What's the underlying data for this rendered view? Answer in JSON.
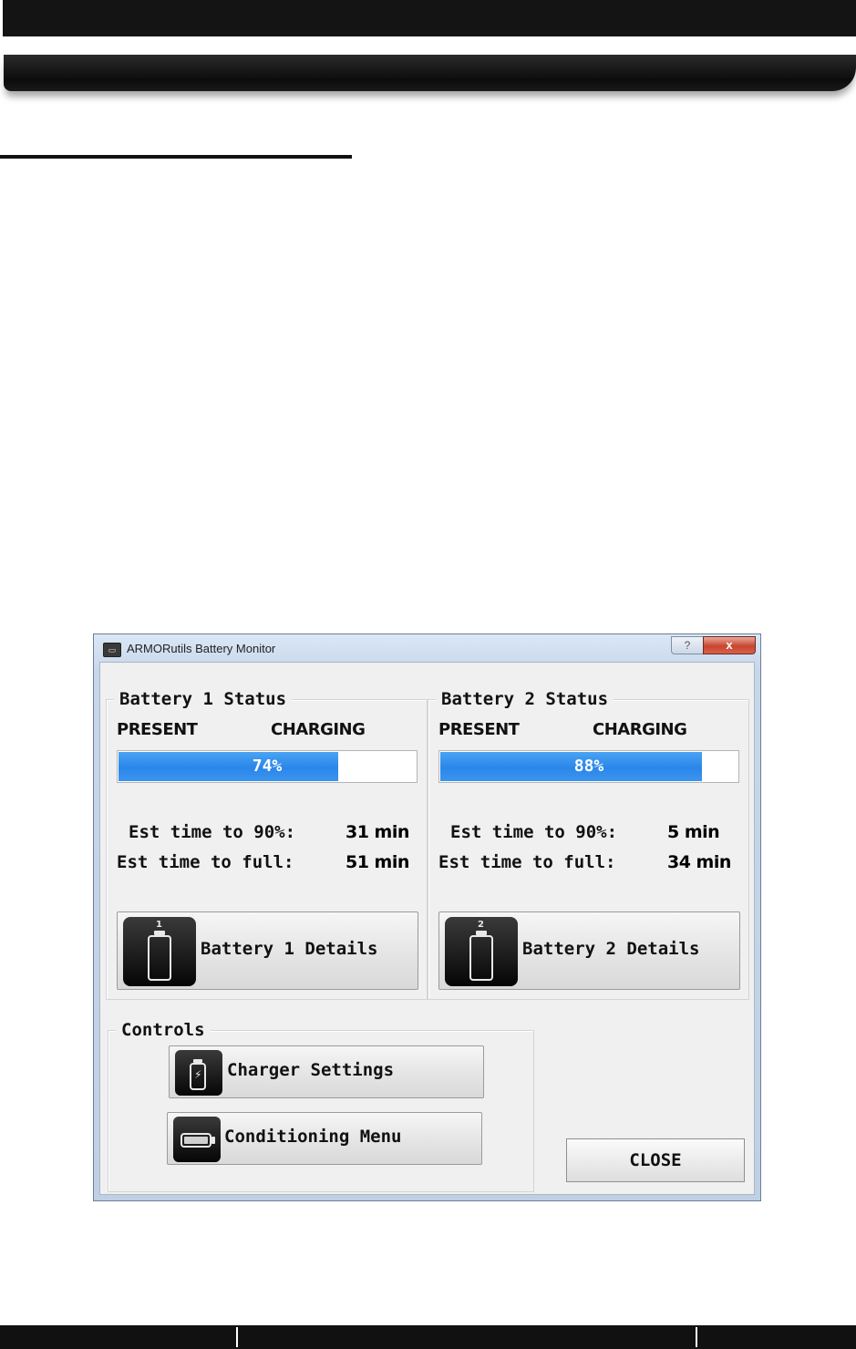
{
  "window": {
    "title": "ARMORutils Battery Monitor",
    "help_glyph": "?",
    "close_glyph": "x"
  },
  "battery1": {
    "legend": "Battery 1 Status",
    "present_label": "PRESENT",
    "charging_label": "CHARGING",
    "charge_percent": 74,
    "charge_text": "74%",
    "est90_label": "Est time to 90%:",
    "est90_value": "31 min",
    "estfull_label": "Est time to full:",
    "estfull_value": "51 min",
    "details_label": "Battery 1 Details",
    "icon_number": "1"
  },
  "battery2": {
    "legend": "Battery 2 Status",
    "present_label": "PRESENT",
    "charging_label": "CHARGING",
    "charge_percent": 88,
    "charge_text": "88%",
    "est90_label": "Est time to 90%:",
    "est90_value": "5 min",
    "estfull_label": "Est time to full:",
    "estfull_value": "34 min",
    "details_label": "Battery 2 Details",
    "icon_number": "2"
  },
  "controls": {
    "legend": "Controls",
    "charger_settings_label": "Charger Settings",
    "conditioning_menu_label": "Conditioning Menu"
  },
  "close_label": "CLOSE",
  "icons": {
    "app": "battery-monitor-icon",
    "battery1": "battery-1-icon",
    "battery2": "battery-2-icon",
    "charger": "charger-icon",
    "conditioning": "conditioning-icon"
  },
  "colors": {
    "progress_fill": "#2a86e9",
    "window_frame": "#c7d7ea",
    "close_caption": "#c8452f"
  }
}
